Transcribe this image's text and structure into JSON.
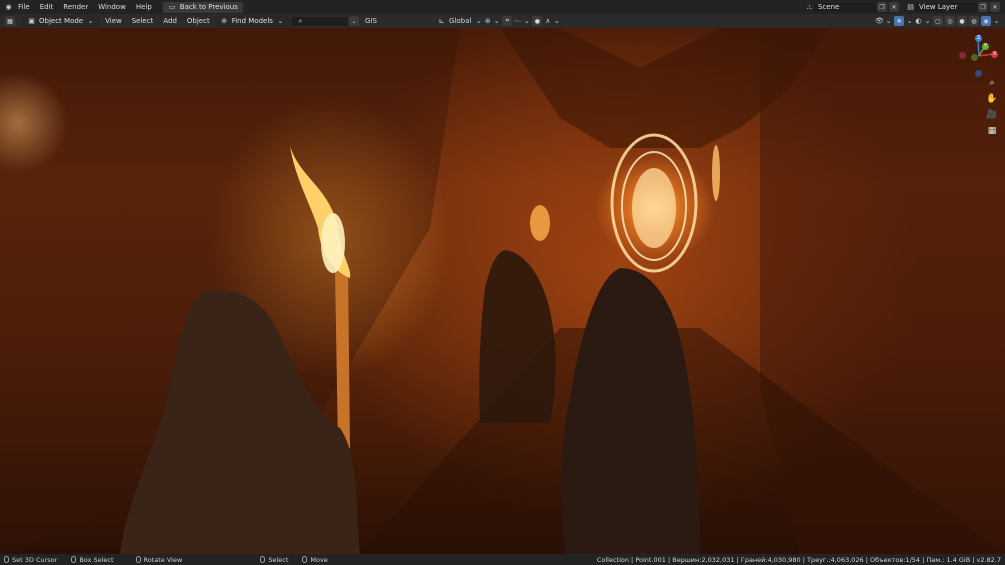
{
  "topbar": {
    "menus": [
      "File",
      "Edit",
      "Render",
      "Window",
      "Help"
    ],
    "back_button": "Back to Previous",
    "scene_label": "Scene",
    "view_layer_label": "View Layer"
  },
  "header": {
    "mode": "Object Mode",
    "menus": [
      "View",
      "Select",
      "Add",
      "Object"
    ],
    "find_models": "Find Models",
    "search_value": "",
    "gis": "GIS",
    "orientation": "Global"
  },
  "statusbar": {
    "items": [
      "Set 3D Cursor",
      "Box Select",
      "Rotate View",
      "Select",
      "Move"
    ],
    "info": "Collection | Point.001 | Вершин:2,032,031 | Граней:4,030,980 | Треуг.:4,063,026 | Объектов:1/54 | Пам.: 1.4 GiB | v2.82.7"
  },
  "gizmo": {
    "z_label": "Z",
    "y_label": "Y",
    "x_label": "X"
  },
  "colors": {
    "accent": "#4b72b0",
    "axis_x": "#d8363c",
    "axis_y": "#6ea62a",
    "axis_z": "#3b7fd6"
  }
}
